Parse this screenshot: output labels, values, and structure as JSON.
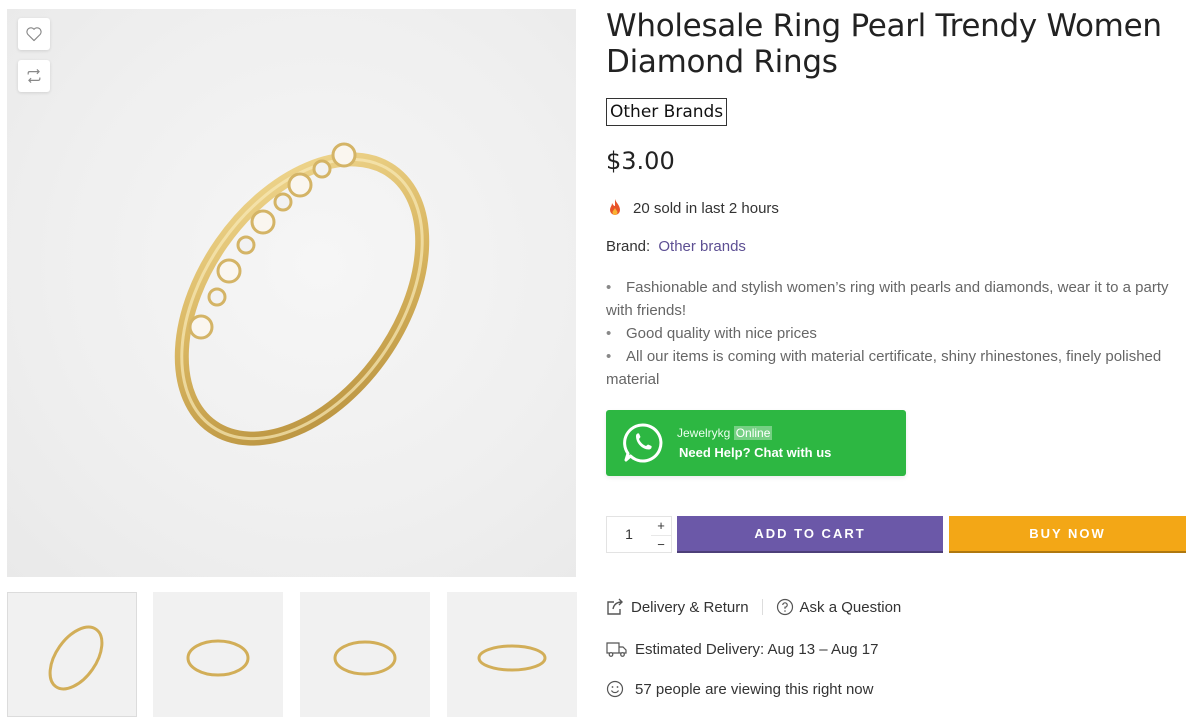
{
  "product": {
    "title": "Wholesale Ring Pearl Trendy Women Diamond Rings",
    "brand_badge": "Other Brands",
    "price": "$3.00",
    "sold_text": "20 sold in last 2 hours",
    "brand_label": "Brand:",
    "brand_value": "Other brands",
    "bullets": [
      "Fashionable and stylish women’s ring with pearls and diamonds, wear it to a party with friends!",
      "Good quality with nice prices",
      "All our items is coming with material certificate, shiny rhinestones, finely polished material"
    ]
  },
  "whatsapp": {
    "name": "Jewelrykg",
    "status": "Online",
    "cta": "Need Help? Chat with us",
    "color": "#2db742"
  },
  "purchase": {
    "quantity": "1",
    "plus": "+",
    "minus": "−",
    "add_to_cart": "ADD TO CART",
    "buy_now": "BUY NOW",
    "cart_color": "#6b58a8",
    "buy_color": "#f3a716"
  },
  "links": {
    "delivery_return": "Delivery & Return",
    "ask_question": "Ask a Question"
  },
  "info": {
    "estimated_delivery": "Estimated Delivery: Aug 13 – Aug 17",
    "viewing": "57 people are viewing this right now"
  },
  "icons": {
    "wishlist": "heart-icon",
    "compare": "compare-arrows-icon",
    "sold": "fire-icon",
    "whatsapp": "whatsapp-icon",
    "delivery_return": "share-box-icon",
    "ask": "question-circle-icon",
    "delivery": "truck-icon",
    "viewing": "smile-icon"
  }
}
